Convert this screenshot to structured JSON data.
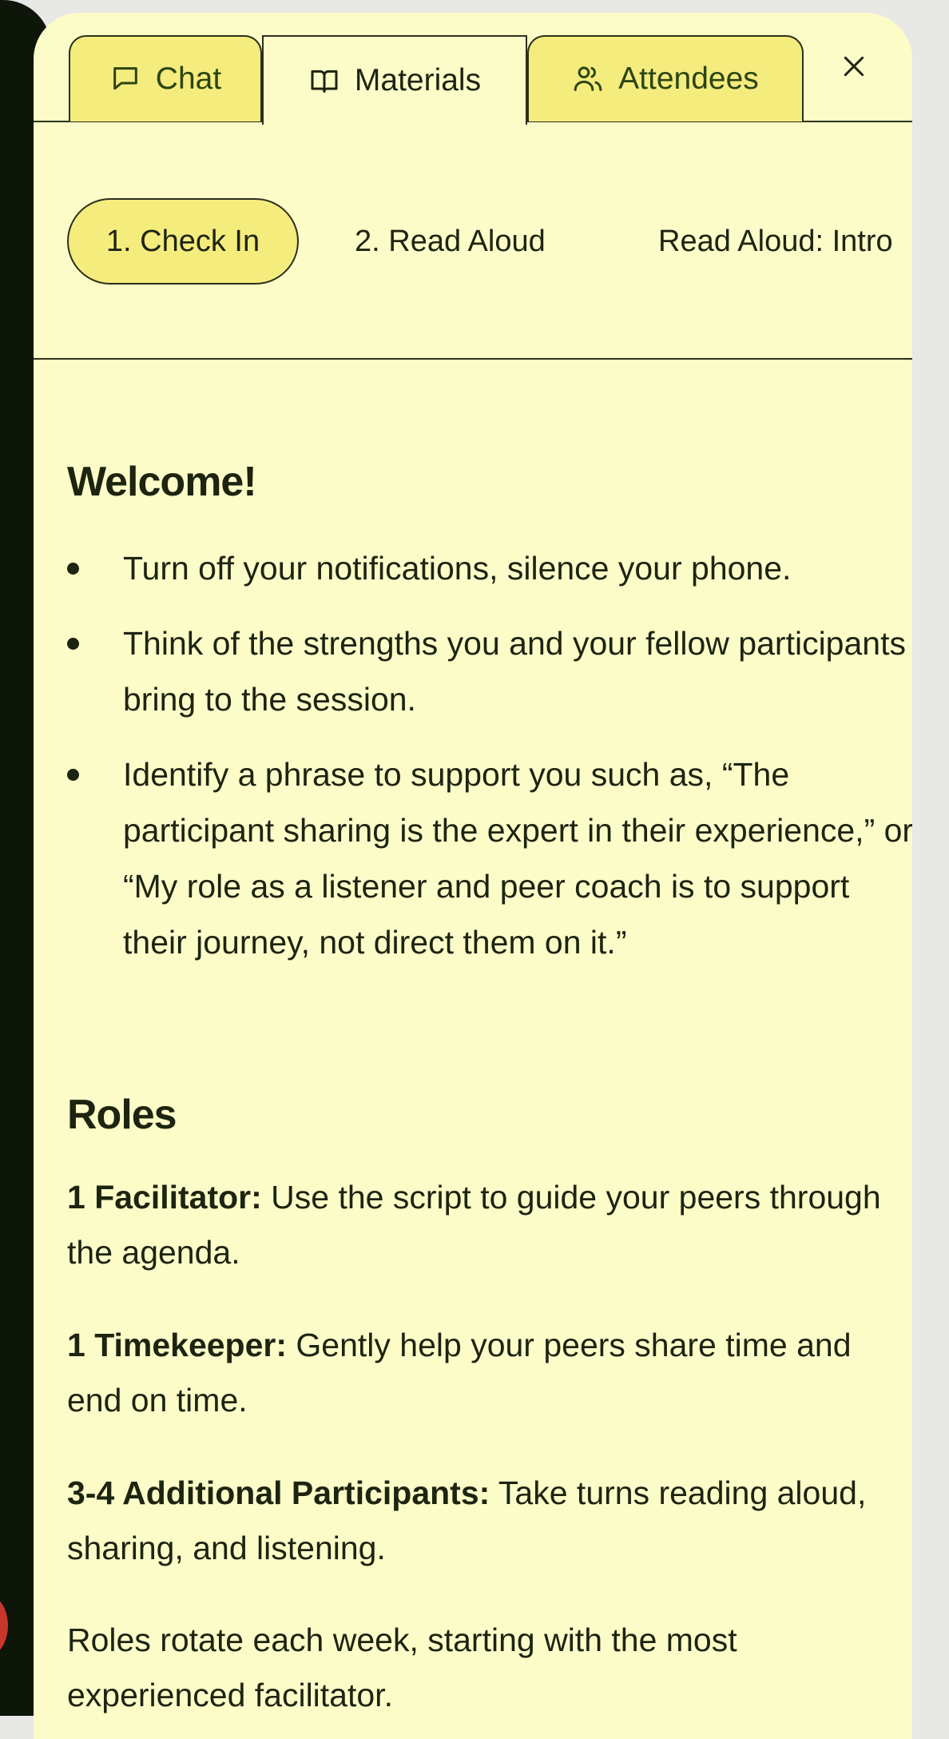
{
  "tabs": [
    {
      "label": "Chat",
      "icon": "chat-bubble-icon"
    },
    {
      "label": "Materials",
      "icon": "book-icon"
    },
    {
      "label": "Attendees",
      "icon": "people-icon"
    }
  ],
  "close_icon": "close-icon",
  "steps": [
    {
      "label": "1. Check In"
    },
    {
      "label": "2. Read Aloud"
    },
    {
      "label": "Read Aloud: Intro"
    }
  ],
  "welcome": {
    "heading": "Welcome!",
    "bullets": [
      "Turn off your notifications, silence your phone.",
      "Think of the strengths you and your fellow participants bring to the session.",
      "Identify a phrase to support you such as, “The participant sharing is the expert in their experience,” or “My role as a listener and peer coach is to support their journey, not direct them on it.”"
    ]
  },
  "roles": {
    "heading": "Roles",
    "items": [
      {
        "title": "1 Facilitator:",
        "text": " Use the script to guide your peers through the agenda."
      },
      {
        "title": "1 Timekeeper:",
        "text": " Gently help your peers share time and end on time."
      },
      {
        "title": "3-4 Additional Participants:",
        "text": " Take turns reading aloud, sharing, and listening."
      }
    ],
    "footer": "Roles rotate each week, starting with the most experienced facilitator."
  },
  "colors": {
    "panel_bg": "#fcfcc9",
    "accent_yellow": "#f5ec7e",
    "text_dark": "#1d2410",
    "tab_text_green": "#2b4511"
  }
}
